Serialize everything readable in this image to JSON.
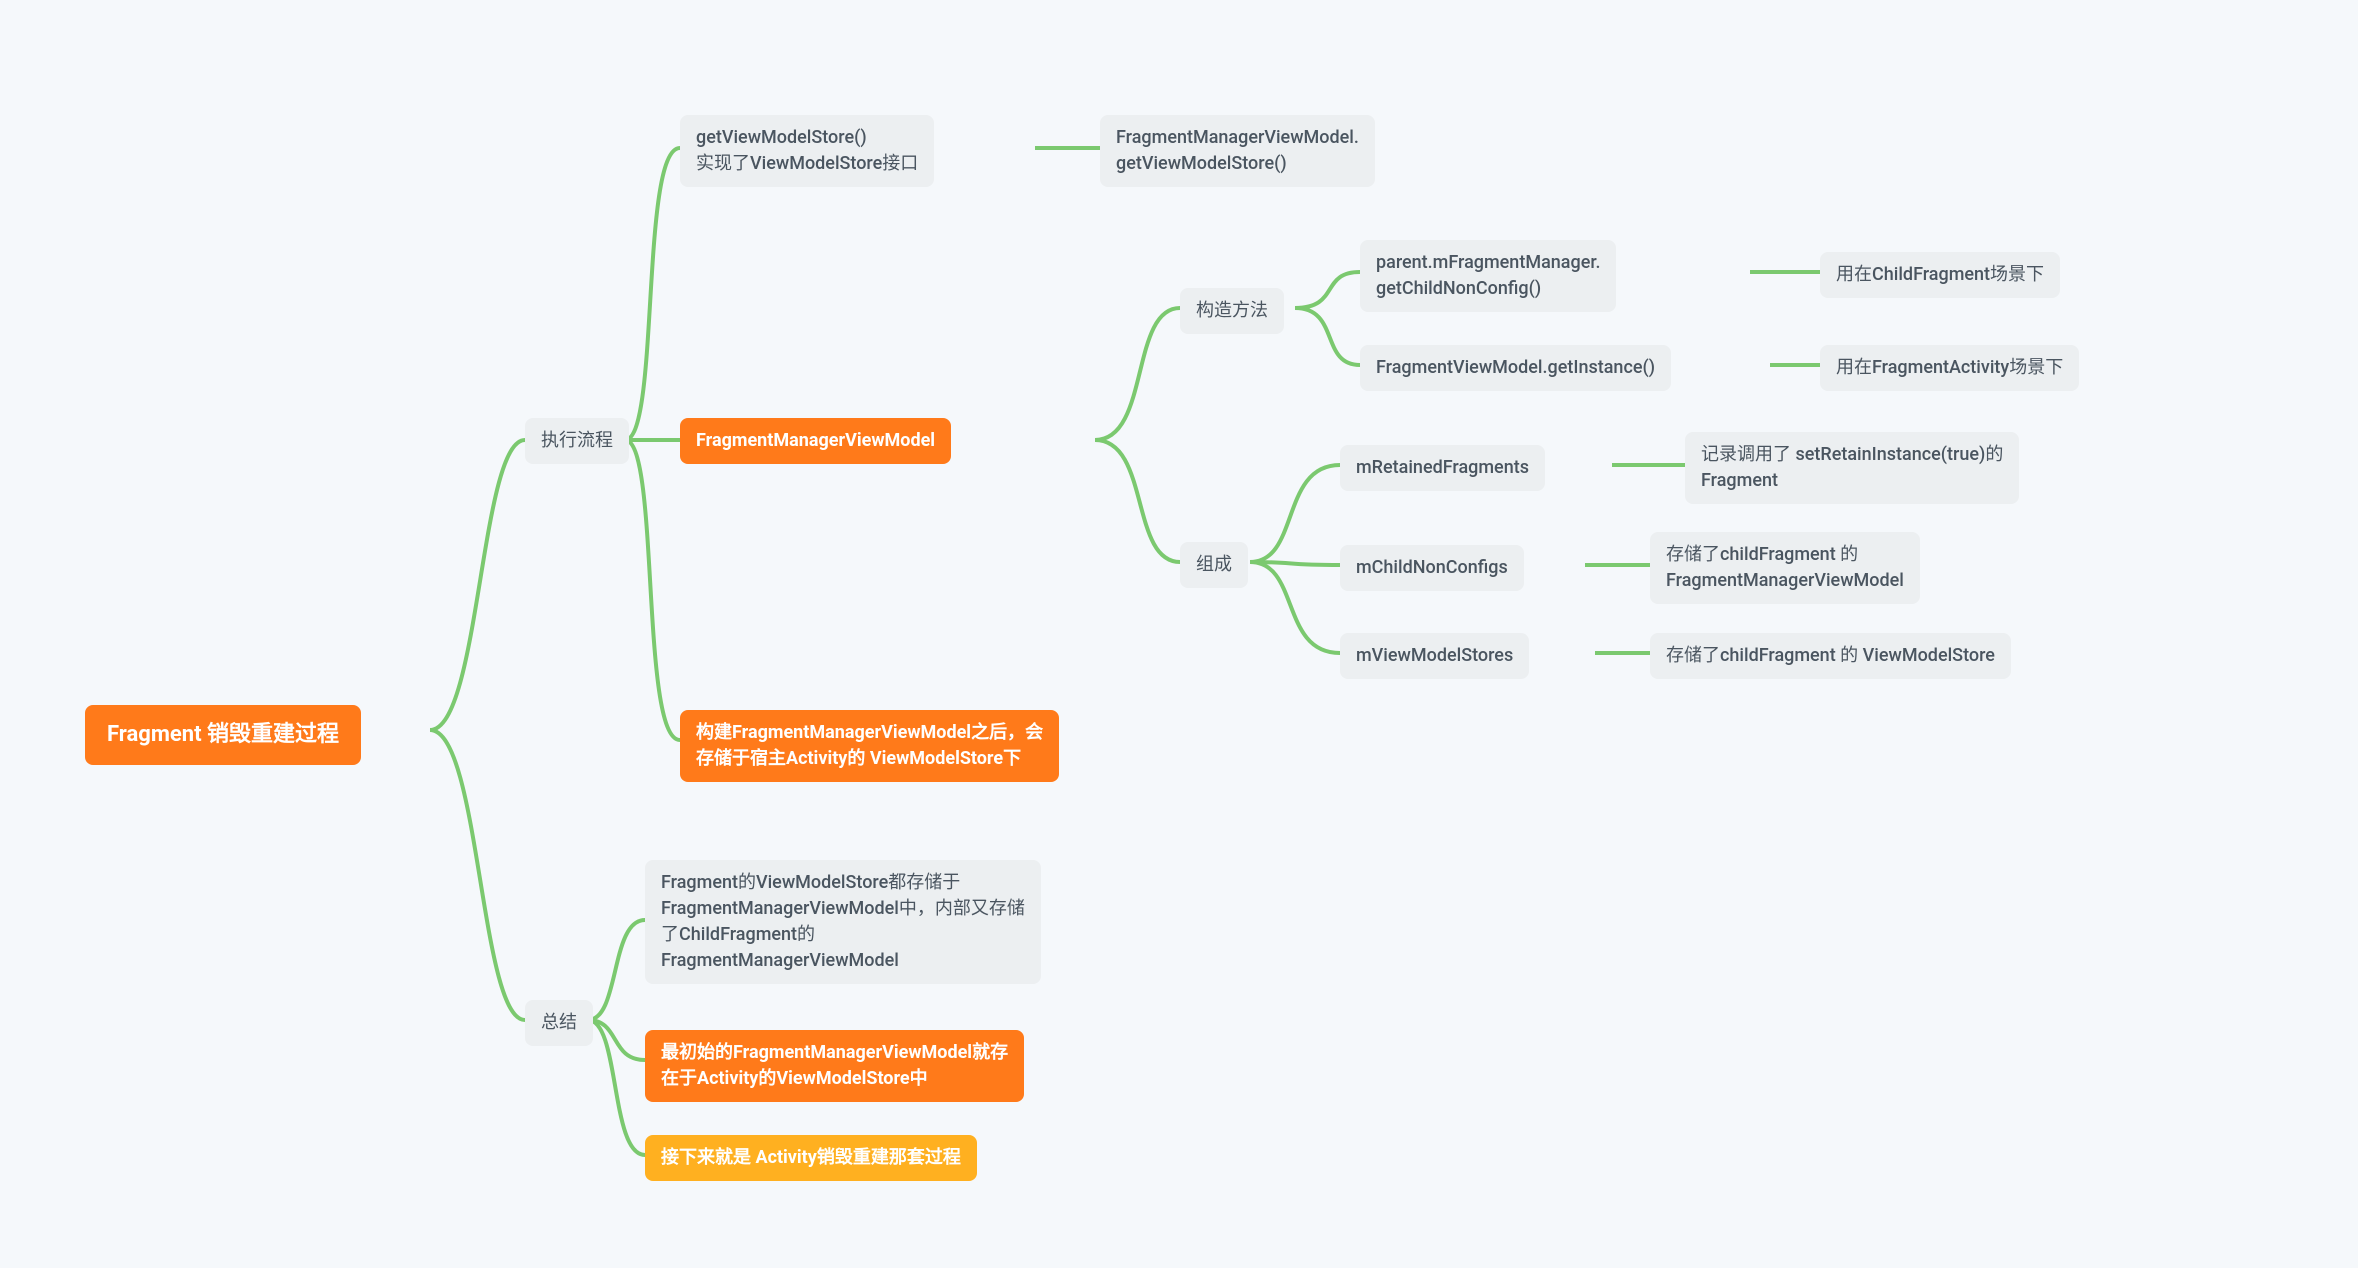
{
  "root": "Fragment 销毁重建过程",
  "b1": {
    "label": "执行流程"
  },
  "b2": {
    "label": "总结"
  },
  "exec": {
    "n1": "getViewModelStore()\n实现了ViewModelStore接口",
    "n1r": "FragmentManagerViewModel.\ngetViewModelStore()",
    "n2": "FragmentManagerViewModel",
    "n3": "构建FragmentManagerViewModel之后，会\n存储于宿主Activity的 ViewModelStore下"
  },
  "fmvm": {
    "ctor": {
      "label": "构造方法",
      "c1": "parent.mFragmentManager.\ngetChildNonConfig()",
      "c1r": "用在ChildFragment场景下",
      "c2": "FragmentViewModel.getInstance()",
      "c2r": "用在FragmentActivity场景下"
    },
    "comp": {
      "label": "组成",
      "m1": "mRetainedFragments",
      "m1r": "记录调用了 setRetainInstance(true)的\nFragment",
      "m2": "mChildNonConfigs",
      "m2r": "存储了childFragment 的\nFragmentManagerViewModel",
      "m3": "mViewModelStores",
      "m3r": "存储了childFragment 的 ViewModelStore"
    }
  },
  "summary": {
    "s1": "Fragment的ViewModelStore都存储于\nFragmentManagerViewModel中，内部又存储\n了ChildFragment的\nFragmentManagerViewModel",
    "s2": "最初始的FragmentManagerViewModel就存\n在于Activity的ViewModelStore中",
    "s3": "接下来就是 Activity销毁重建那套过程"
  }
}
